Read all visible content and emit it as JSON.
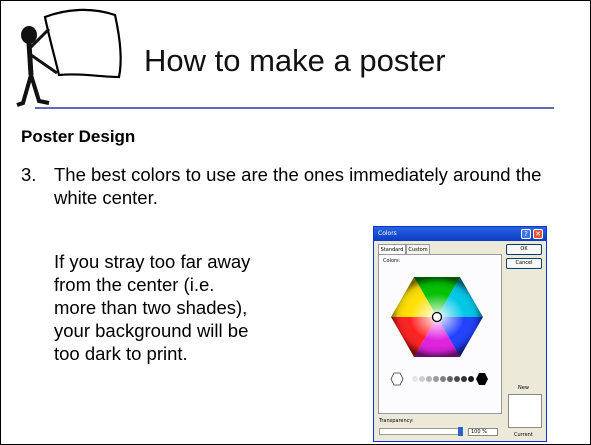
{
  "slide": {
    "title": "How to make a poster",
    "heading": "Poster Design",
    "point_number": "3.",
    "point_text": "The best colors to use are the ones immediately around the white center.",
    "paragraph": "If you stray too far away from the center (i.e. more than two shades), your background will be too dark to print.",
    "accent_color": "#5f6cb5",
    "clipart_icon": "stick-figure-holding-sign-icon"
  },
  "colors_dialog": {
    "title": "Colors",
    "help_glyph": "?",
    "close_glyph": "✕",
    "tabs": [
      {
        "label": "Standard",
        "selected": true
      },
      {
        "label": "Custom",
        "selected": false
      }
    ],
    "colors_label": "Colors:",
    "ok_label": "OK",
    "cancel_label": "Cancel",
    "new_label": "New",
    "current_label": "Current",
    "transparency_label": "Transparency:",
    "transparency_value": "100 %",
    "title_bar_color": "#0a3bc6",
    "face_color": "#ece9d8"
  }
}
